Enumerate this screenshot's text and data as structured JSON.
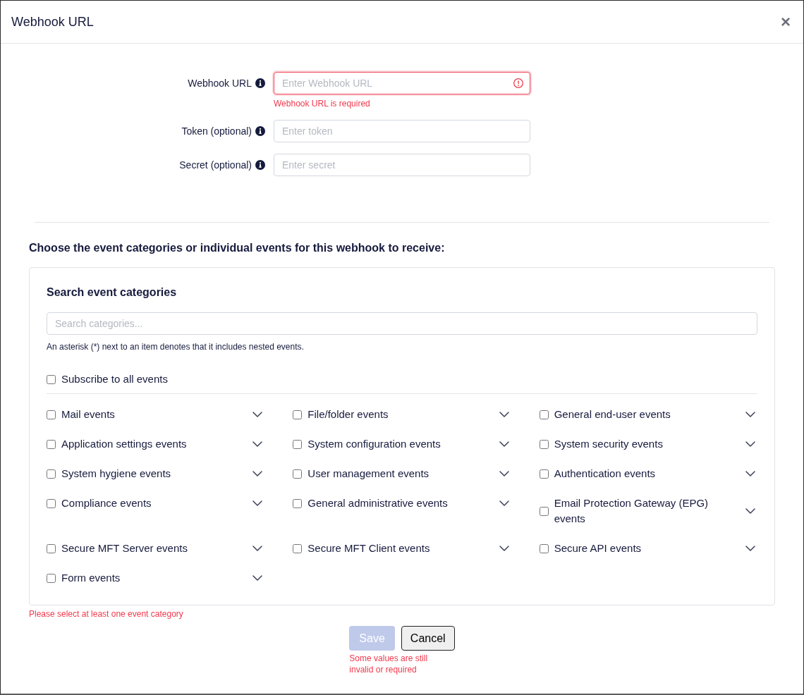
{
  "dialog": {
    "title": "Webhook URL",
    "close": "×"
  },
  "fields": [
    {
      "label": "Webhook URL",
      "placeholder": "Enter Webhook URL",
      "invalid": true,
      "error": "Webhook URL is required"
    },
    {
      "label": "Token (optional)",
      "placeholder": "Enter token",
      "invalid": false
    },
    {
      "label": "Secret (optional)",
      "placeholder": "Enter secret",
      "invalid": false
    }
  ],
  "events": {
    "heading": "Choose the event categories or individual events for this webhook to receive:",
    "search_title": "Search event categories",
    "search": {
      "placeholder": "Search categories..."
    },
    "hint": "An asterisk (*) next to an item denotes that it includes nested events.",
    "subscribe_all": {
      "label": "Subscribe to all events",
      "checked": false
    },
    "categories": [
      {
        "label": "Mail events",
        "checked": false,
        "expanded": false
      },
      {
        "label": "File/folder events",
        "checked": false,
        "expanded": false
      },
      {
        "label": "General end-user events",
        "checked": false,
        "expanded": false
      },
      {
        "label": "Application settings events",
        "checked": false,
        "expanded": false
      },
      {
        "label": "System configuration events",
        "checked": false,
        "expanded": false
      },
      {
        "label": "System security events",
        "checked": false,
        "expanded": false
      },
      {
        "label": "System hygiene events",
        "checked": false,
        "expanded": false
      },
      {
        "label": "User management events",
        "checked": false,
        "expanded": false
      },
      {
        "label": "Authentication events",
        "checked": false,
        "expanded": false
      },
      {
        "label": "Compliance events",
        "checked": false,
        "expanded": false
      },
      {
        "label": "General administrative events",
        "checked": false,
        "expanded": false
      },
      {
        "label": "Email Protection Gateway (EPG) events",
        "checked": false,
        "expanded": false
      },
      {
        "label": "Secure MFT Server events",
        "checked": false,
        "expanded": false
      },
      {
        "label": "Secure MFT Client events",
        "checked": false,
        "expanded": false
      },
      {
        "label": "Secure API events",
        "checked": false,
        "expanded": false
      },
      {
        "label": "Form events",
        "checked": false,
        "expanded": false
      }
    ],
    "error": "Please select at least one event category"
  },
  "buttons": [
    {
      "label": "Save",
      "kind": "primary",
      "disabled": true
    },
    {
      "label": "Cancel",
      "kind": "secondary",
      "disabled": false
    }
  ],
  "form_error": "Some values are still invalid or required"
}
